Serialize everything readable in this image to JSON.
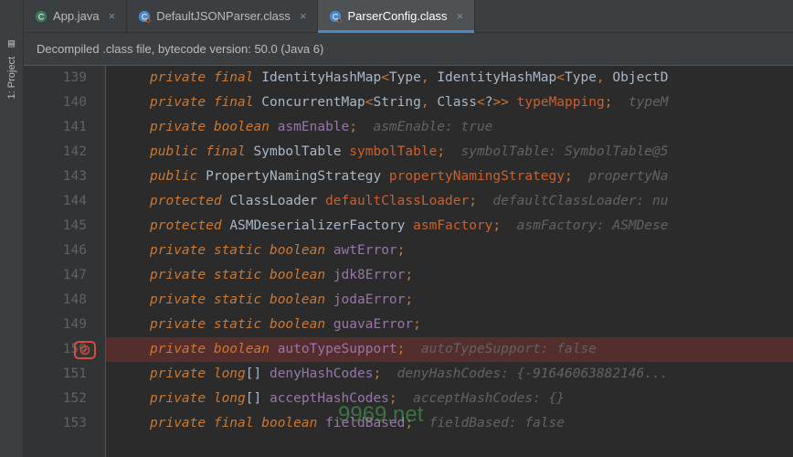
{
  "rail": {
    "label": "1: Project"
  },
  "tabs": [
    {
      "label": "App.java",
      "active": false,
      "icon": "java"
    },
    {
      "label": "DefaultJSONParser.class",
      "active": false,
      "icon": "class"
    },
    {
      "label": "ParserConfig.class",
      "active": true,
      "icon": "class"
    }
  ],
  "banner": "Decompiled .class file, bytecode version: 50.0 (Java 6)",
  "lines": [
    {
      "num": "139",
      "tokens": [
        [
          "kw",
          "private"
        ],
        [
          "sp",
          " "
        ],
        [
          "kw",
          "final"
        ],
        [
          "sp",
          " "
        ],
        [
          "type",
          "IdentityHashMap"
        ],
        [
          "punct",
          "<"
        ],
        [
          "type",
          "Type"
        ],
        [
          "punct",
          ","
        ],
        [
          "sp",
          " "
        ],
        [
          "type",
          "IdentityHashMap"
        ],
        [
          "punct",
          "<"
        ],
        [
          "type",
          "Type"
        ],
        [
          "punct",
          ","
        ],
        [
          "sp",
          " "
        ],
        [
          "type",
          "ObjectD"
        ]
      ]
    },
    {
      "num": "140",
      "tokens": [
        [
          "kw",
          "private"
        ],
        [
          "sp",
          " "
        ],
        [
          "kw",
          "final"
        ],
        [
          "sp",
          " "
        ],
        [
          "type",
          "ConcurrentMap"
        ],
        [
          "punct",
          "<"
        ],
        [
          "type",
          "String"
        ],
        [
          "punct",
          ","
        ],
        [
          "sp",
          " "
        ],
        [
          "type",
          "Class"
        ],
        [
          "punct",
          "<"
        ],
        [
          "type",
          "?"
        ],
        [
          "punct",
          ">>"
        ],
        [
          "sp",
          " "
        ],
        [
          "field",
          "typeMapping"
        ],
        [
          "punct",
          ";"
        ],
        [
          "sp",
          "  "
        ],
        [
          "hint",
          "typeM"
        ]
      ]
    },
    {
      "num": "141",
      "tokens": [
        [
          "kw",
          "private"
        ],
        [
          "sp",
          " "
        ],
        [
          "kw",
          "boolean"
        ],
        [
          "sp",
          " "
        ],
        [
          "ident",
          "asmEnable"
        ],
        [
          "punct",
          ";"
        ],
        [
          "sp",
          "  "
        ],
        [
          "hint",
          "asmEnable: true"
        ]
      ]
    },
    {
      "num": "142",
      "tokens": [
        [
          "kw",
          "public"
        ],
        [
          "sp",
          " "
        ],
        [
          "kw",
          "final"
        ],
        [
          "sp",
          " "
        ],
        [
          "type",
          "SymbolTable"
        ],
        [
          "sp",
          " "
        ],
        [
          "field",
          "symbolTable"
        ],
        [
          "punct",
          ";"
        ],
        [
          "sp",
          "  "
        ],
        [
          "hint",
          "symbolTable: SymbolTable@5"
        ]
      ]
    },
    {
      "num": "143",
      "tokens": [
        [
          "kw",
          "public"
        ],
        [
          "sp",
          " "
        ],
        [
          "type",
          "PropertyNamingStrategy"
        ],
        [
          "sp",
          " "
        ],
        [
          "field",
          "propertyNamingStrategy"
        ],
        [
          "punct",
          ";"
        ],
        [
          "sp",
          "  "
        ],
        [
          "hint",
          "propertyNa"
        ]
      ]
    },
    {
      "num": "144",
      "tokens": [
        [
          "kw",
          "protected"
        ],
        [
          "sp",
          " "
        ],
        [
          "type",
          "ClassLoader"
        ],
        [
          "sp",
          " "
        ],
        [
          "field",
          "defaultClassLoader"
        ],
        [
          "punct",
          ";"
        ],
        [
          "sp",
          "  "
        ],
        [
          "hint",
          "defaultClassLoader: nu"
        ]
      ]
    },
    {
      "num": "145",
      "tokens": [
        [
          "kw",
          "protected"
        ],
        [
          "sp",
          " "
        ],
        [
          "type",
          "ASMDeserializerFactory"
        ],
        [
          "sp",
          " "
        ],
        [
          "field",
          "asmFactory"
        ],
        [
          "punct",
          ";"
        ],
        [
          "sp",
          "  "
        ],
        [
          "hint",
          "asmFactory: ASMDese"
        ]
      ]
    },
    {
      "num": "146",
      "tokens": [
        [
          "kw",
          "private"
        ],
        [
          "sp",
          " "
        ],
        [
          "kw",
          "static"
        ],
        [
          "sp",
          " "
        ],
        [
          "kw",
          "boolean"
        ],
        [
          "sp",
          " "
        ],
        [
          "ident",
          "awtError"
        ],
        [
          "punct",
          ";"
        ]
      ]
    },
    {
      "num": "147",
      "tokens": [
        [
          "kw",
          "private"
        ],
        [
          "sp",
          " "
        ],
        [
          "kw",
          "static"
        ],
        [
          "sp",
          " "
        ],
        [
          "kw",
          "boolean"
        ],
        [
          "sp",
          " "
        ],
        [
          "ident",
          "jdk8Error"
        ],
        [
          "punct",
          ";"
        ]
      ]
    },
    {
      "num": "148",
      "tokens": [
        [
          "kw",
          "private"
        ],
        [
          "sp",
          " "
        ],
        [
          "kw",
          "static"
        ],
        [
          "sp",
          " "
        ],
        [
          "kw",
          "boolean"
        ],
        [
          "sp",
          " "
        ],
        [
          "ident",
          "jodaError"
        ],
        [
          "punct",
          ";"
        ]
      ]
    },
    {
      "num": "149",
      "tokens": [
        [
          "kw",
          "private"
        ],
        [
          "sp",
          " "
        ],
        [
          "kw",
          "static"
        ],
        [
          "sp",
          " "
        ],
        [
          "kw",
          "boolean"
        ],
        [
          "sp",
          " "
        ],
        [
          "ident",
          "guavaError"
        ],
        [
          "punct",
          ";"
        ]
      ]
    },
    {
      "num": "150",
      "hl": true,
      "bp": true,
      "tokens": [
        [
          "kw",
          "private"
        ],
        [
          "sp",
          " "
        ],
        [
          "kw",
          "boolean"
        ],
        [
          "sp",
          " "
        ],
        [
          "ident",
          "autoTypeSupport"
        ],
        [
          "punct",
          ";"
        ],
        [
          "sp",
          "  "
        ],
        [
          "hint",
          "autoTypeSupport: false"
        ]
      ]
    },
    {
      "num": "151",
      "tokens": [
        [
          "kw",
          "private"
        ],
        [
          "sp",
          " "
        ],
        [
          "kw",
          "long"
        ],
        [
          "type",
          "[]"
        ],
        [
          "sp",
          " "
        ],
        [
          "ident",
          "denyHashCodes"
        ],
        [
          "punct",
          ";"
        ],
        [
          "sp",
          "  "
        ],
        [
          "hint",
          "denyHashCodes: {-91646063882146..."
        ]
      ]
    },
    {
      "num": "152",
      "tokens": [
        [
          "kw",
          "private"
        ],
        [
          "sp",
          " "
        ],
        [
          "kw",
          "long"
        ],
        [
          "type",
          "[]"
        ],
        [
          "sp",
          " "
        ],
        [
          "ident",
          "acceptHashCodes"
        ],
        [
          "punct",
          ";"
        ],
        [
          "sp",
          "  "
        ],
        [
          "hint",
          "acceptHashCodes: {}"
        ]
      ]
    },
    {
      "num": "153",
      "tokens": [
        [
          "kw",
          "private"
        ],
        [
          "sp",
          " "
        ],
        [
          "kw",
          "final"
        ],
        [
          "sp",
          " "
        ],
        [
          "kw",
          "boolean"
        ],
        [
          "sp",
          " "
        ],
        [
          "ident",
          "fieldBased"
        ],
        [
          "punct",
          ";"
        ],
        [
          "sp",
          "  "
        ],
        [
          "hint",
          "fieldBased: false"
        ]
      ]
    }
  ],
  "watermark": "9969.net"
}
